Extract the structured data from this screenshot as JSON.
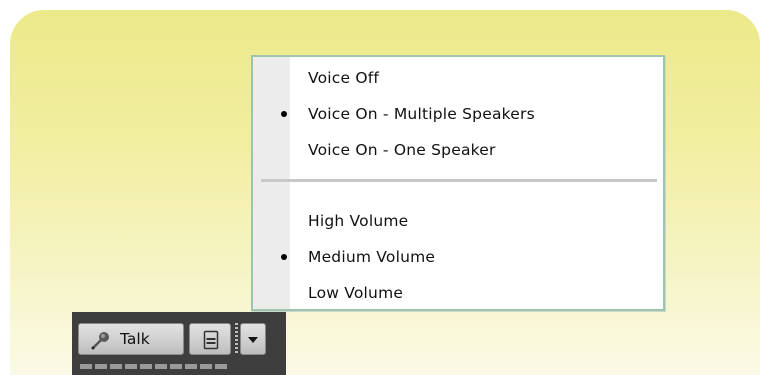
{
  "voice_menu": {
    "voice_mode_items": [
      {
        "label": "Voice Off",
        "checked": false
      },
      {
        "label": "Voice On - Multiple Speakers",
        "checked": true
      },
      {
        "label": "Voice On - One Speaker",
        "checked": false
      }
    ],
    "volume_items": [
      {
        "label": "High Volume",
        "checked": false
      },
      {
        "label": "Medium Volume",
        "checked": true
      },
      {
        "label": "Low Volume",
        "checked": false
      }
    ]
  },
  "toolbar": {
    "talk_label": "Talk",
    "talk_icon": "microphone-icon",
    "lock_icon": "lock-icon",
    "dropdown_icon": "chevron-down-icon",
    "level_meter_segments": 10,
    "level_meter_active": 0
  },
  "colors": {
    "background_top": "#ece98a",
    "background_bottom": "#fbfae6",
    "menu_border": "#9fc4ac",
    "toolbar_bg": "#3e3e3e"
  }
}
